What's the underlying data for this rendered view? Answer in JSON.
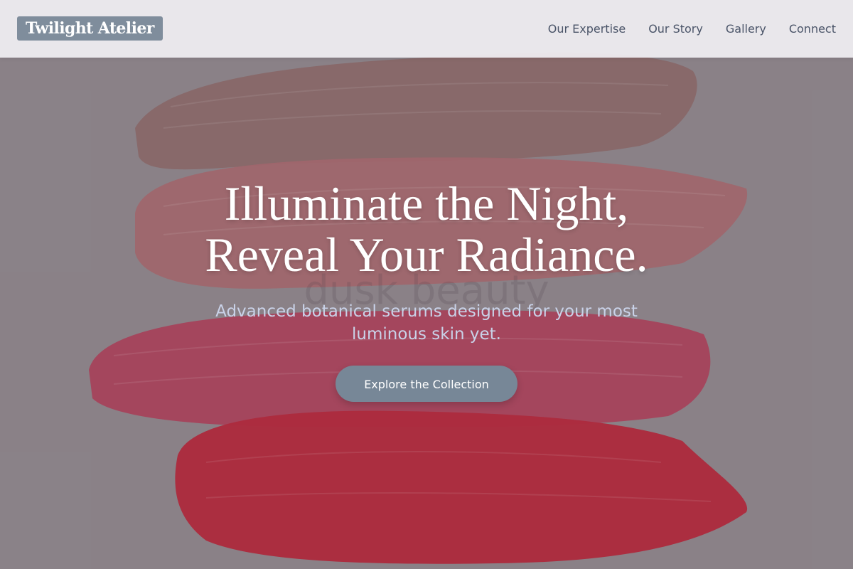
{
  "header": {
    "logo": "Twilight Atelier",
    "nav": [
      {
        "label": "Our Expertise"
      },
      {
        "label": "Our Story"
      },
      {
        "label": "Gallery"
      },
      {
        "label": "Connect"
      }
    ]
  },
  "hero": {
    "title_line1": "Illuminate the Night,",
    "title_line2": "Reveal Your Radiance.",
    "subtitle": "Advanced botanical serums designed for your most luminous skin yet.",
    "cta_label": "Explore the Collection"
  },
  "background": {
    "watermark_text": "dusk beauty",
    "swatch_colors": [
      "#8b6666",
      "#a8656c",
      "#b03a55",
      "#b81d33"
    ]
  },
  "colors": {
    "header_bg": "#eeecf0",
    "logo_bg": "#7f8d9c",
    "nav_text": "#4a5468",
    "cta_bg": "#778797",
    "subtitle": "#c9d2e8"
  }
}
